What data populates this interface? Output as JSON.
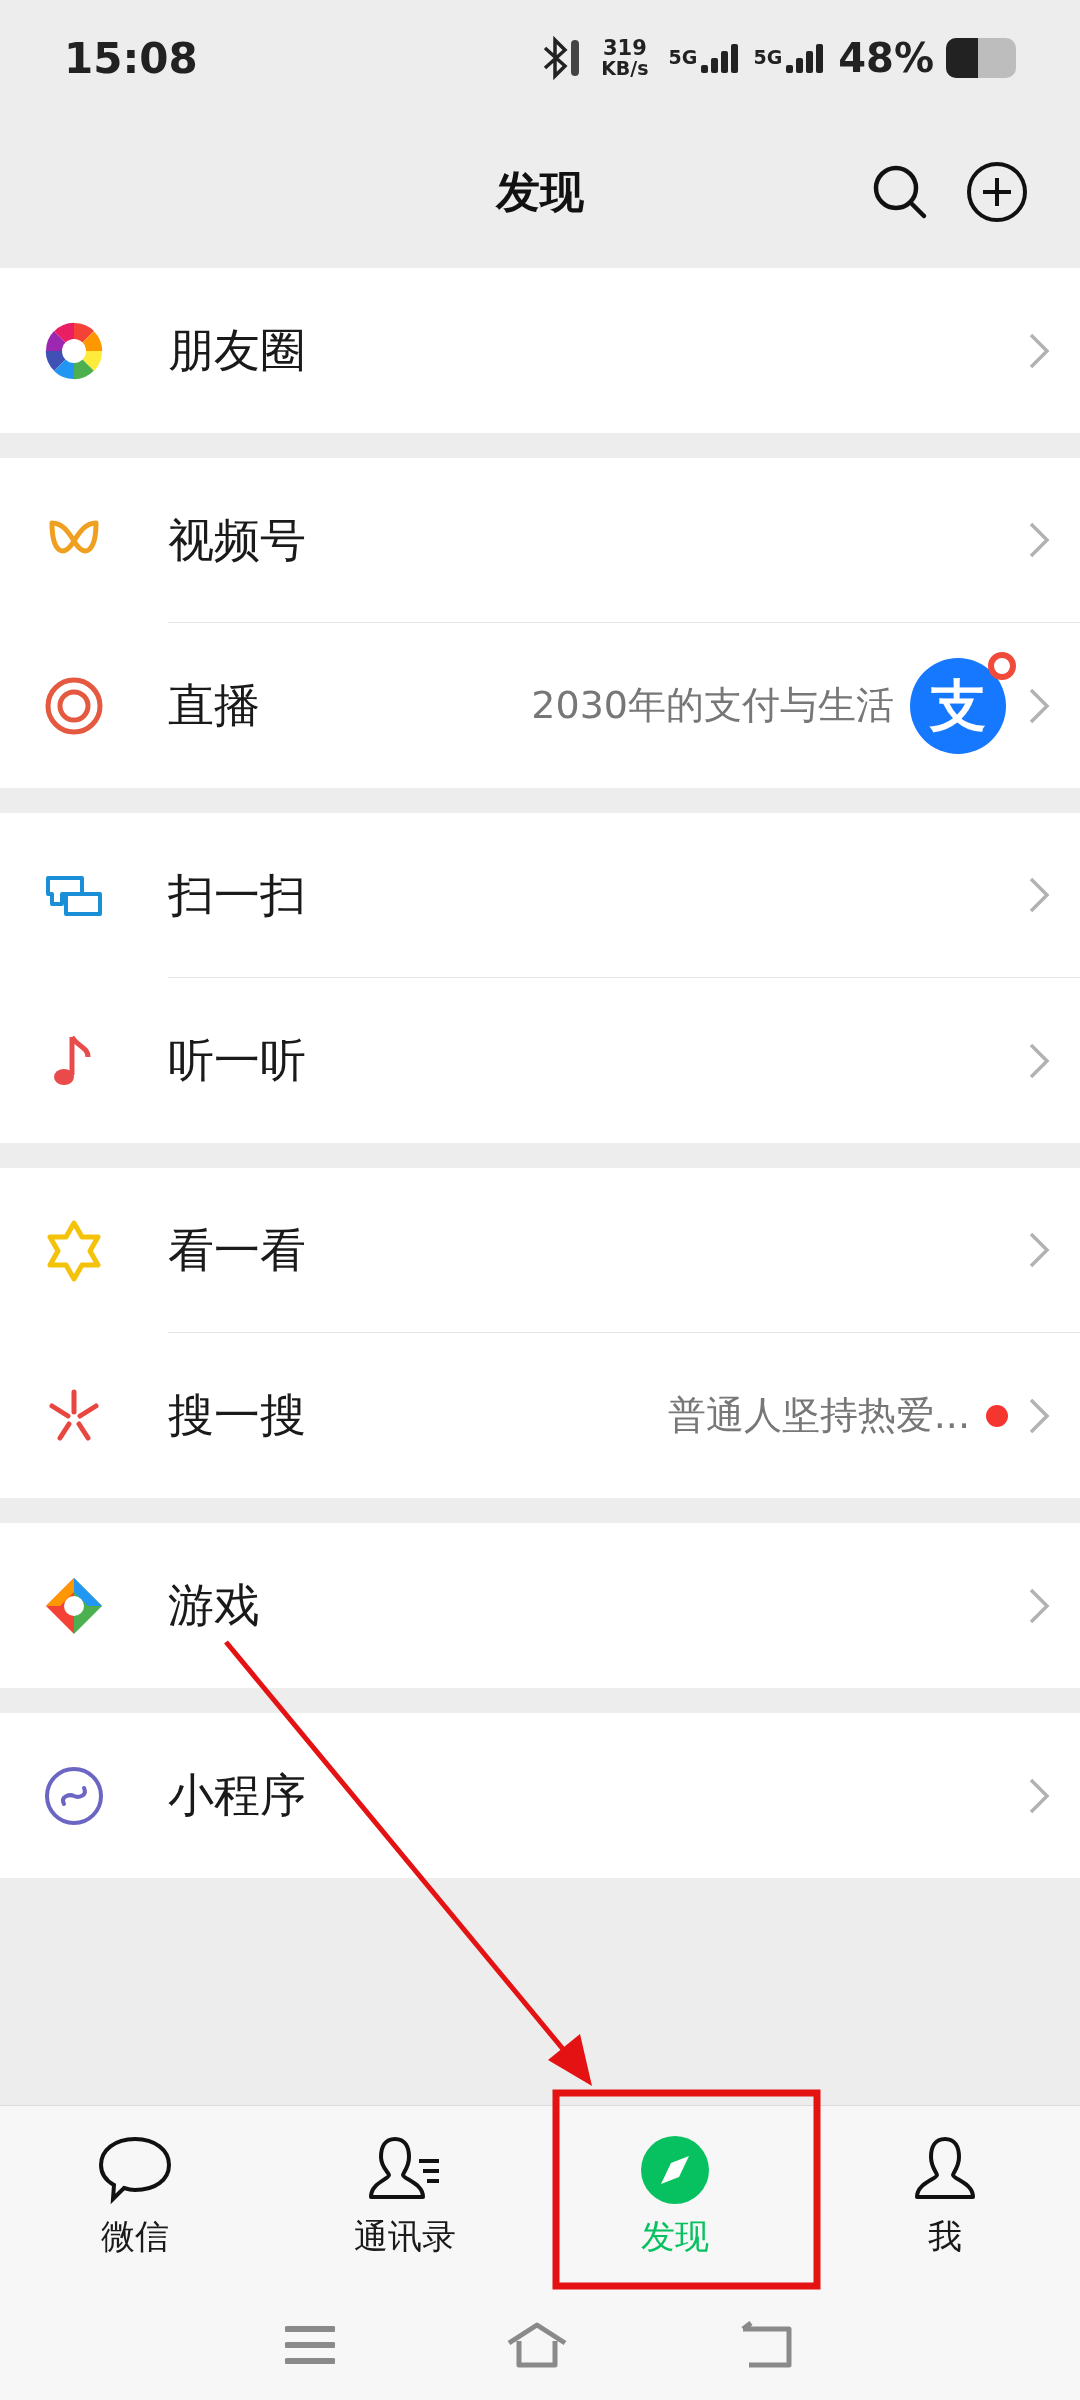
{
  "status_bar": {
    "time": "15:08",
    "speed": "319",
    "speed_unit": "KB/s",
    "sim_1": "5G",
    "sim_2": "5G",
    "battery": "48%"
  },
  "header": {
    "title": "发现"
  },
  "groups": [
    {
      "items": [
        {
          "kind": "plain",
          "label": "朋友圈"
        }
      ]
    },
    {
      "items": [
        {
          "kind": "plain",
          "label": "视频号"
        },
        {
          "kind": "promo",
          "label": "直播",
          "subtitle": "2030年的支付与生活",
          "avatar_text": "支",
          "badge": true
        }
      ]
    },
    {
      "items": [
        {
          "kind": "plain",
          "label": "扫一扫"
        },
        {
          "kind": "plain",
          "label": "听一听"
        }
      ]
    },
    {
      "items": [
        {
          "kind": "plain",
          "label": "看一看"
        },
        {
          "kind": "notice",
          "label": "搜一搜",
          "subtitle": "普通人坚持热爱...",
          "badge": true
        }
      ]
    },
    {
      "items": [
        {
          "kind": "plain",
          "label": "游戏"
        }
      ]
    },
    {
      "items": [
        {
          "kind": "plain",
          "label": "小程序"
        }
      ]
    }
  ],
  "tabs": [
    {
      "label": "微信",
      "selected": false
    },
    {
      "label": "通讯录",
      "selected": false
    },
    {
      "label": "发现",
      "selected": true
    },
    {
      "label": "我",
      "selected": false
    }
  ]
}
